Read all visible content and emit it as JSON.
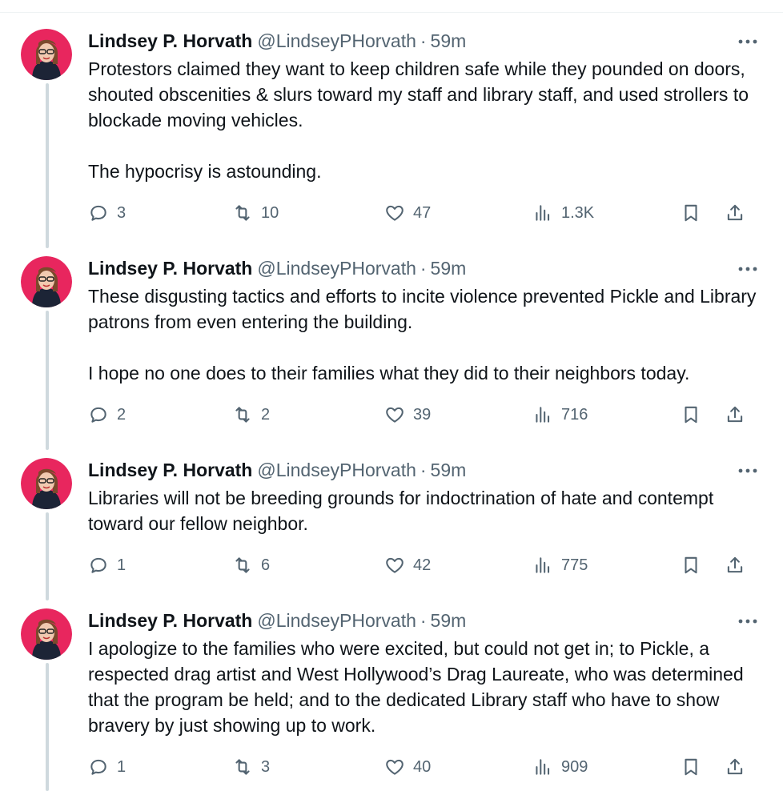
{
  "colors": {
    "text_primary": "#0f1419",
    "text_secondary": "#536471",
    "thread_line": "#cfd9de",
    "avatar_bg": "#e8265e"
  },
  "icons": {
    "reply": "reply-icon",
    "retweet": "retweet-icon",
    "like": "heart-icon",
    "views": "views-bar-chart-icon",
    "bookmark": "bookmark-icon",
    "share": "share-icon",
    "more": "more-dots-icon"
  },
  "tweets": [
    {
      "author": {
        "name": "Lindsey P. Horvath",
        "handle": "@LindseyPHorvath",
        "separator": "·",
        "time": "59m"
      },
      "paragraphs": [
        "Protestors claimed they want to keep children safe while they pounded on doors, shouted obscenities & slurs toward my staff and library staff, and used strollers to blockade moving vehicles.",
        "The hypocrisy is astounding."
      ],
      "stats": {
        "replies": "3",
        "retweets": "10",
        "likes": "47",
        "views": "1.3K"
      }
    },
    {
      "author": {
        "name": "Lindsey P. Horvath",
        "handle": "@LindseyPHorvath",
        "separator": "·",
        "time": "59m"
      },
      "paragraphs": [
        "These disgusting tactics and efforts to incite violence prevented Pickle and Library patrons from even entering the building.",
        "I hope no one does to their families what they did to their neighbors today."
      ],
      "stats": {
        "replies": "2",
        "retweets": "2",
        "likes": "39",
        "views": "716"
      }
    },
    {
      "author": {
        "name": "Lindsey P. Horvath",
        "handle": "@LindseyPHorvath",
        "separator": "·",
        "time": "59m"
      },
      "paragraphs": [
        "Libraries will not be breeding grounds for indoctrination of hate and contempt toward our fellow neighbor."
      ],
      "stats": {
        "replies": "1",
        "retweets": "6",
        "likes": "42",
        "views": "775"
      }
    },
    {
      "author": {
        "name": "Lindsey P. Horvath",
        "handle": "@LindseyPHorvath",
        "separator": "·",
        "time": "59m"
      },
      "paragraphs": [
        "I apologize to the families who were excited, but could not get in; to Pickle, a respected drag artist and West Hollywood’s Drag Laureate, who was determined that the program be held; and to the dedicated Library staff who have to show bravery by just showing up to work."
      ],
      "stats": {
        "replies": "1",
        "retweets": "3",
        "likes": "40",
        "views": "909"
      }
    }
  ]
}
